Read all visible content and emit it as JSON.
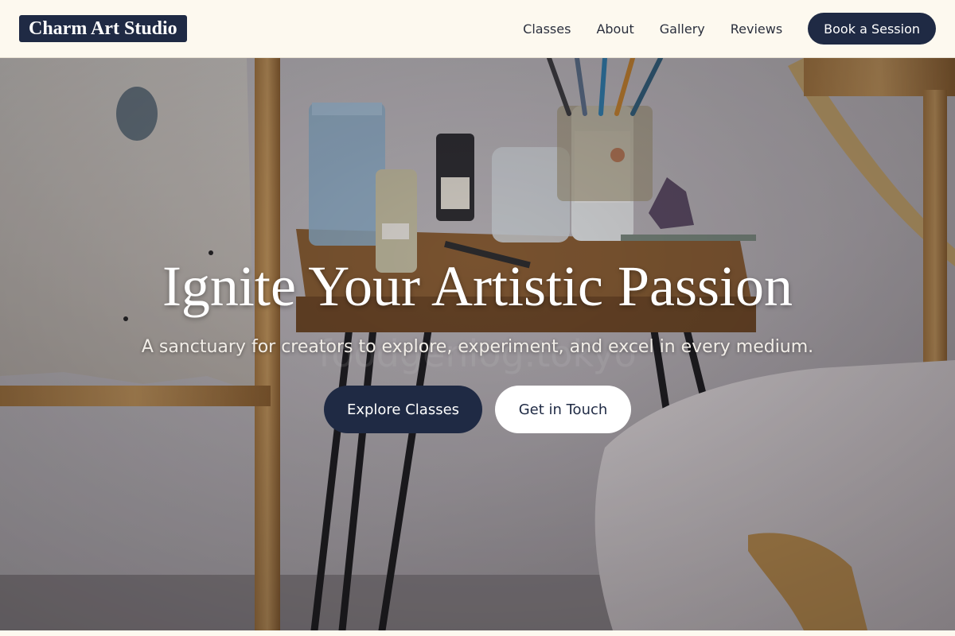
{
  "brand": {
    "name": "Charm Art Studio"
  },
  "nav": {
    "items": [
      {
        "label": "Classes"
      },
      {
        "label": "About"
      },
      {
        "label": "Gallery"
      },
      {
        "label": "Reviews"
      }
    ],
    "cta_label": "Book a Session"
  },
  "hero": {
    "title": "Ignite Your Artistic Passion",
    "subtitle": "A sanctuary for creators to explore, experiment, and excel in every medium.",
    "primary_cta": "Explore Classes",
    "secondary_cta": "Get in Touch",
    "watermark": "foodgenlog.tokyo"
  },
  "colors": {
    "brand_navy": "#1f2a44",
    "header_bg": "#fdf9ef",
    "white": "#ffffff"
  }
}
